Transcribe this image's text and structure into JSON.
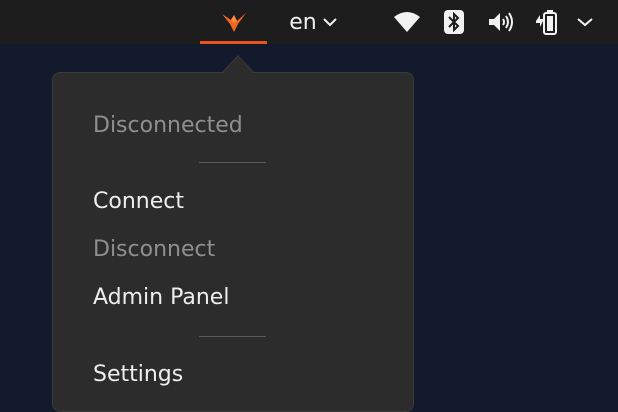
{
  "top_bar": {
    "app_indicator": {
      "icon": "orange-bird-logo-icon",
      "accent": "#e95420"
    },
    "language": {
      "label": "en"
    },
    "system_icons": [
      "wifi-icon",
      "bluetooth-icon",
      "volume-icon",
      "battery-icon",
      "chevron-down-icon"
    ]
  },
  "menu": {
    "status": "Disconnected",
    "items": [
      {
        "label": "Connect",
        "enabled": true
      },
      {
        "label": "Disconnect",
        "enabled": false
      },
      {
        "label": "Admin Panel",
        "enabled": true
      },
      {
        "label": "Settings",
        "enabled": true
      }
    ]
  }
}
